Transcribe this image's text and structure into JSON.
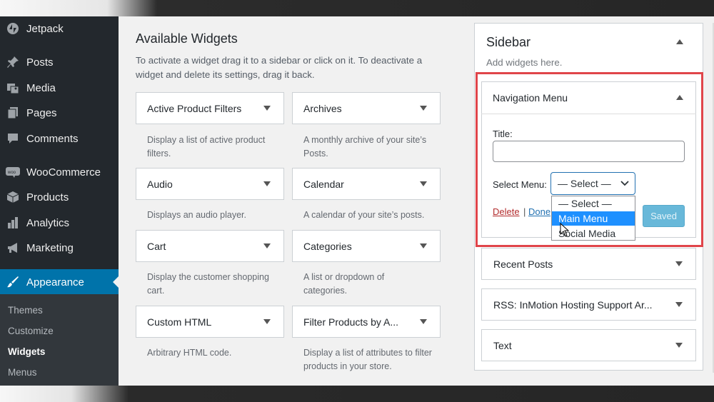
{
  "admin_menu": {
    "items": [
      {
        "label": "Jetpack",
        "icon": "jetpack-icon"
      },
      {
        "label": "Posts",
        "icon": "pin-icon"
      },
      {
        "label": "Media",
        "icon": "media-icon"
      },
      {
        "label": "Pages",
        "icon": "pages-icon"
      },
      {
        "label": "Comments",
        "icon": "comment-icon"
      },
      {
        "label": "WooCommerce",
        "icon": "woo-icon"
      },
      {
        "label": "Products",
        "icon": "box-icon"
      },
      {
        "label": "Analytics",
        "icon": "bar-chart-icon"
      },
      {
        "label": "Marketing",
        "icon": "megaphone-icon"
      },
      {
        "label": "Appearance",
        "icon": "brush-icon"
      }
    ],
    "submenu": [
      "Themes",
      "Customize",
      "Widgets",
      "Menus"
    ],
    "active_color": "#0073aa"
  },
  "available_widgets": {
    "title": "Available Widgets",
    "description": "To activate a widget drag it to a sidebar or click on it. To deactivate a widget and delete its settings, drag it back.",
    "widgets": [
      {
        "name": "Active Product Filters",
        "desc": "Display a list of active product filters."
      },
      {
        "name": "Archives",
        "desc": "A monthly archive of your site’s Posts."
      },
      {
        "name": "Audio",
        "desc": "Displays an audio player."
      },
      {
        "name": "Calendar",
        "desc": "A calendar of your site’s posts."
      },
      {
        "name": "Cart",
        "desc": "Display the customer shopping cart."
      },
      {
        "name": "Categories",
        "desc": "A list or dropdown of categories."
      },
      {
        "name": "Custom HTML",
        "desc": "Arbitrary HTML code."
      },
      {
        "name": "Filter Products by A...",
        "desc": "Display a list of attributes to filter products in your store."
      }
    ]
  },
  "sidebar": {
    "title": "Sidebar",
    "hint": "Add widgets here.",
    "nav_menu": {
      "title": "Navigation Menu",
      "title_label": "Title:",
      "title_value": "",
      "select_label": "Select Menu:",
      "select_value": "— Select —",
      "options": [
        "— Select —",
        "Main Menu",
        "Social Media"
      ],
      "highlighted_option": "Main Menu",
      "delete_label": "Delete",
      "separator": "|",
      "done_label": "Done",
      "saved_label": "Saved"
    },
    "widgets": [
      "Recent Posts",
      "RSS: InMotion Hosting Support Ar...",
      "Text"
    ]
  },
  "colors": {
    "highlight_border": "#e0454a",
    "saved_button": "#68b8d9",
    "option_selected": "#1e90ff"
  }
}
